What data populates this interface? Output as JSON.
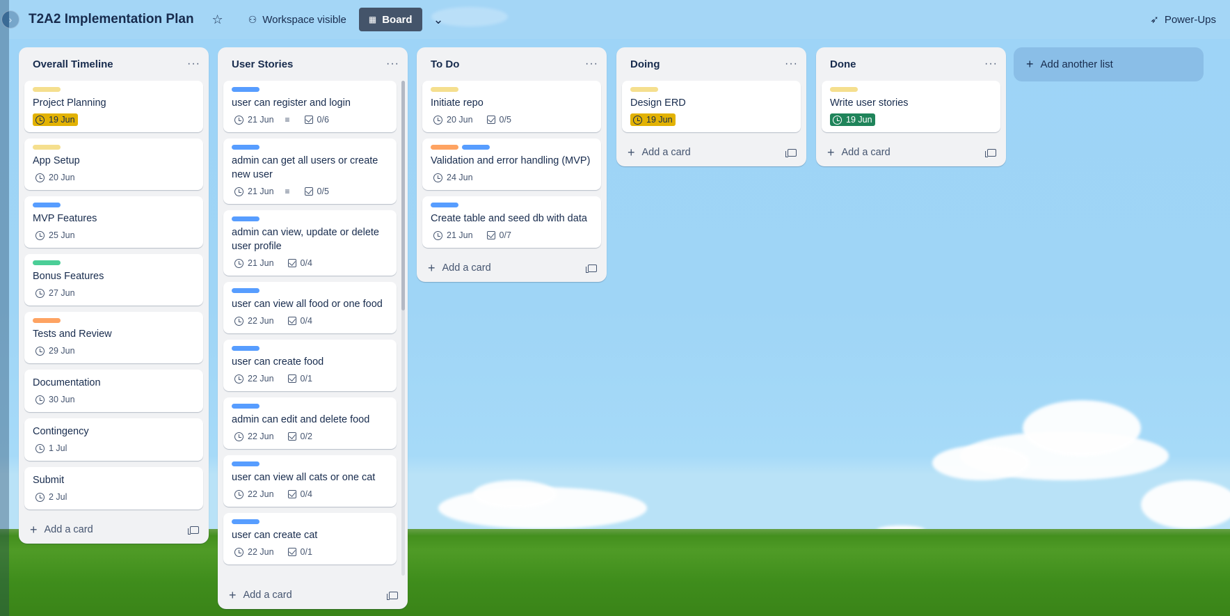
{
  "header": {
    "title": "T2A2 Implementation Plan",
    "workspace_label": "Workspace visible",
    "board_label": "Board",
    "powerups_label": "Power-Ups"
  },
  "add_card_label": "Add a card",
  "add_list_label": "Add another list",
  "colors": {
    "yellow": "#f5df8e",
    "blue": "#579dff",
    "green": "#4bce97",
    "orange": "#fea362"
  },
  "lists": [
    {
      "title": "Overall Timeline",
      "cards": [
        {
          "labels": [
            "yellow"
          ],
          "title": "Project Planning",
          "due": "19 Jun",
          "due_style": "warn"
        },
        {
          "labels": [
            "yellow"
          ],
          "title": "App Setup",
          "due": "20 Jun"
        },
        {
          "labels": [
            "blue"
          ],
          "title": "MVP Features",
          "due": "25 Jun"
        },
        {
          "labels": [
            "green"
          ],
          "title": "Bonus Features",
          "due": "27 Jun"
        },
        {
          "labels": [
            "orange"
          ],
          "title": "Tests and Review",
          "due": "29 Jun"
        },
        {
          "labels": [],
          "title": "Documentation",
          "due": "30 Jun"
        },
        {
          "labels": [],
          "title": "Contingency",
          "due": "1 Jul"
        },
        {
          "labels": [],
          "title": "Submit",
          "due": "2 Jul"
        }
      ]
    },
    {
      "title": "User Stories",
      "cards": [
        {
          "labels": [
            "blue"
          ],
          "title": "user can register and login",
          "due": "21 Jun",
          "desc": true,
          "check": "0/6"
        },
        {
          "labels": [
            "blue"
          ],
          "title": "admin can get all users or create new user",
          "due": "21 Jun",
          "desc": true,
          "check": "0/5"
        },
        {
          "labels": [
            "blue"
          ],
          "title": "admin can view, update or delete user profile",
          "due": "21 Jun",
          "check": "0/4"
        },
        {
          "labels": [
            "blue"
          ],
          "title": "user can view all food or one food",
          "due": "22 Jun",
          "check": "0/4"
        },
        {
          "labels": [
            "blue"
          ],
          "title": "user can create food",
          "due": "22 Jun",
          "check": "0/1"
        },
        {
          "labels": [
            "blue"
          ],
          "title": "admin can edit and delete food",
          "due": "22 Jun",
          "check": "0/2"
        },
        {
          "labels": [
            "blue"
          ],
          "title": "user can view all cats or one cat",
          "due": "22 Jun",
          "check": "0/4"
        },
        {
          "labels": [
            "blue"
          ],
          "title": "user can create cat",
          "due": "22 Jun",
          "check": "0/1"
        }
      ]
    },
    {
      "title": "To Do",
      "cards": [
        {
          "labels": [
            "yellow"
          ],
          "title": "Initiate repo",
          "due": "20 Jun",
          "check": "0/5"
        },
        {
          "labels": [
            "orange",
            "blue"
          ],
          "title": "Validation and error handling (MVP)",
          "due": "24 Jun"
        },
        {
          "labels": [
            "blue"
          ],
          "title": "Create table and seed db with data",
          "due": "21 Jun",
          "check": "0/7"
        }
      ]
    },
    {
      "title": "Doing",
      "cards": [
        {
          "labels": [
            "yellow"
          ],
          "title": "Design ERD",
          "due": "19 Jun",
          "due_style": "warn"
        }
      ]
    },
    {
      "title": "Done",
      "cards": [
        {
          "labels": [
            "yellow"
          ],
          "title": "Write user stories",
          "due": "19 Jun",
          "due_style": "done"
        }
      ]
    }
  ]
}
